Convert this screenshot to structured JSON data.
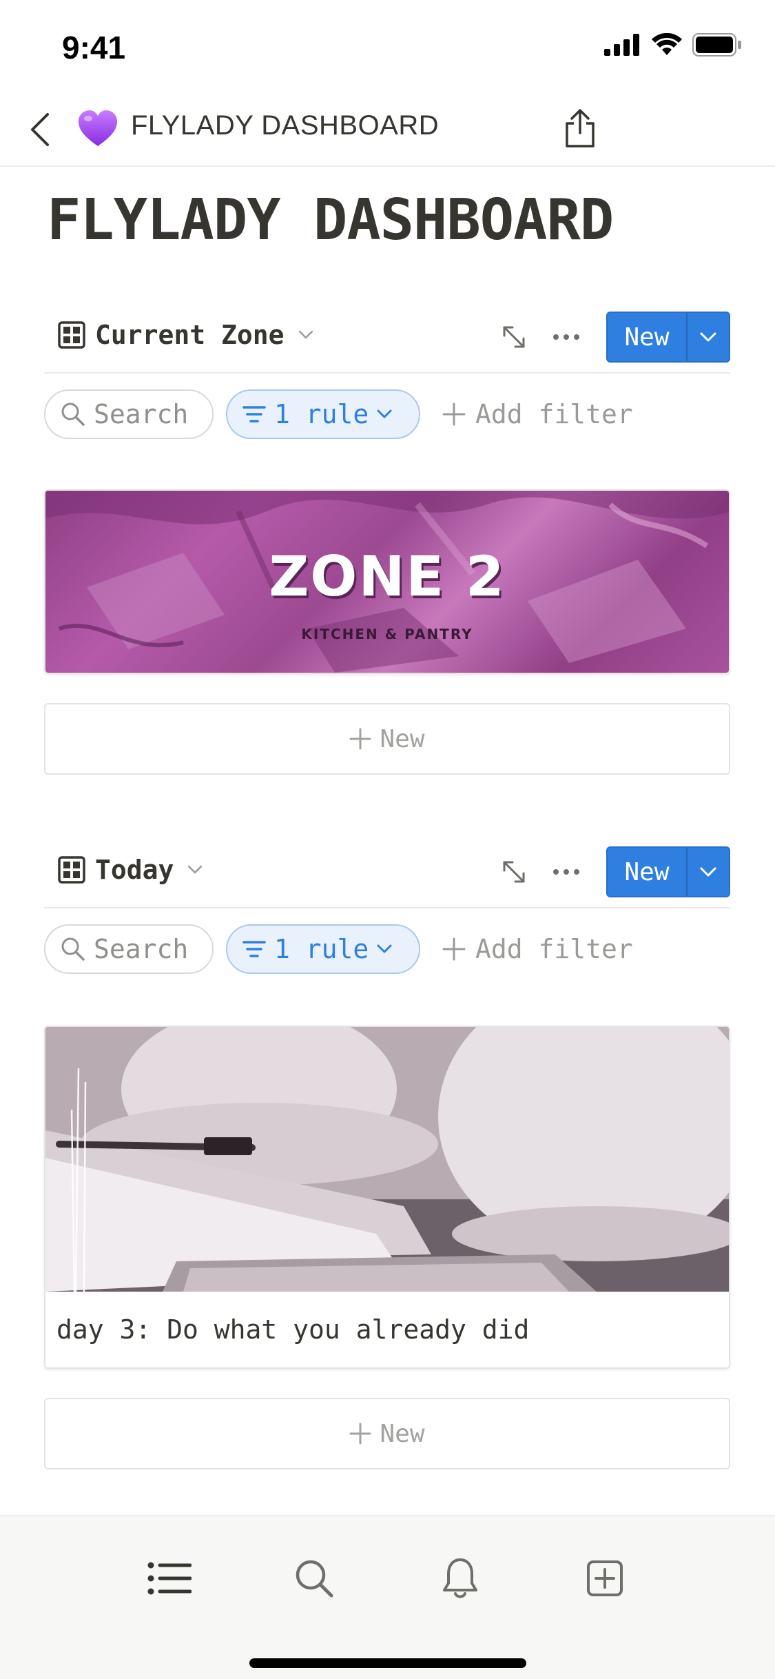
{
  "status_bar": {
    "time": "9:41"
  },
  "navbar": {
    "title": "FLYLADY DASHBOARD",
    "emoji": "purple-heart"
  },
  "page": {
    "title": "FLYLADY DASHBOARD"
  },
  "sections": [
    {
      "title": "Current Zone",
      "new_label": "New",
      "search_label": "Search",
      "rule_label": "1 rule",
      "add_filter_label": "Add filter",
      "card": {
        "cover_title": "ZONE 2",
        "cover_subtitle": "KITCHEN & PANTRY"
      },
      "new_row_label": "New"
    },
    {
      "title": "Today",
      "new_label": "New",
      "search_label": "Search",
      "rule_label": "1 rule",
      "add_filter_label": "Add filter",
      "card": {
        "caption": "day 3: Do what you already did"
      },
      "new_row_label": "New"
    }
  ],
  "colors": {
    "accent": "#2f7fe0",
    "text": "#37352f",
    "muted": "#9b9a97",
    "zone_purple": "#a04f96"
  },
  "tabbar": {
    "items": [
      "list-icon",
      "search-icon",
      "bell-icon",
      "add-page-icon"
    ]
  }
}
